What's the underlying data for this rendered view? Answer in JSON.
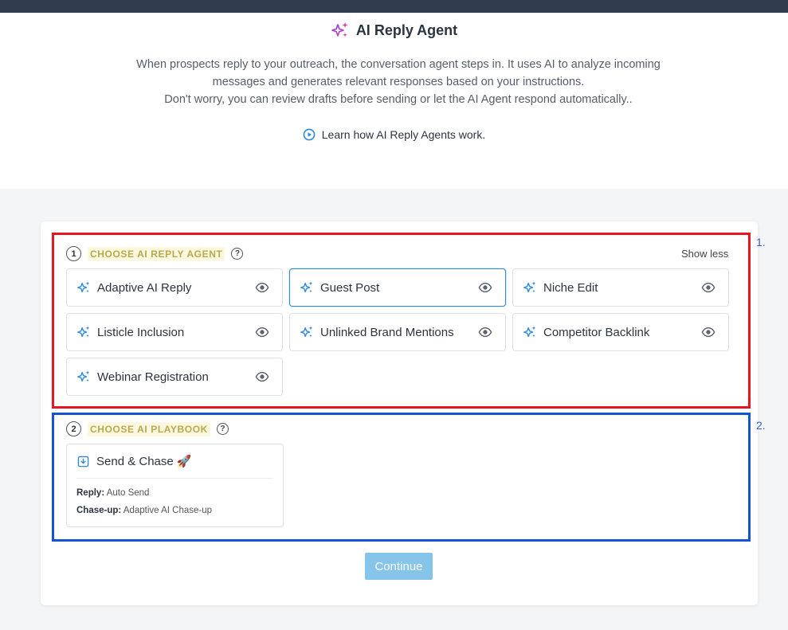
{
  "header": {
    "title": "AI Reply Agent",
    "icon": "sparkles-icon",
    "description_lines": [
      "When prospects reply to your outreach, the conversation agent steps in. It uses AI to analyze incoming",
      "messages and generates relevant responses based on your instructions.",
      "Don't worry, you can review drafts before sending or let the AI Agent respond automatically.."
    ],
    "learn_link": "Learn how AI Reply Agents work."
  },
  "step1": {
    "number": "1",
    "label": "CHOOSE AI REPLY AGENT",
    "help": "?",
    "toggle": "Show less",
    "agents": [
      {
        "label": "Adaptive AI Reply",
        "selected": false
      },
      {
        "label": "Guest Post",
        "selected": true
      },
      {
        "label": "Niche Edit",
        "selected": false
      },
      {
        "label": "Listicle Inclusion",
        "selected": false
      },
      {
        "label": "Unlinked Brand Mentions",
        "selected": false
      },
      {
        "label": "Competitor Backlink",
        "selected": false
      },
      {
        "label": "Webinar Registration",
        "selected": false
      }
    ]
  },
  "step2": {
    "number": "2",
    "label": "CHOOSE AI PLAYBOOK",
    "help": "?",
    "playbook": {
      "title": "Send & Chase 🚀",
      "reply_key": "Reply:",
      "reply_value": "Auto Send",
      "chase_key": "Chase-up:",
      "chase_value": "Adaptive AI Chase-up"
    }
  },
  "annotations": {
    "box1": "1.",
    "box2": "2."
  },
  "footer": {
    "continue_label": "Continue"
  },
  "colors": {
    "topbar": "#2f3d4e",
    "accent_blue": "#2f87d8",
    "step_label": "#b9a94b",
    "continue_bg": "#86c4ea",
    "annotation_red": "#e5161f",
    "annotation_blue": "#1453d6"
  }
}
